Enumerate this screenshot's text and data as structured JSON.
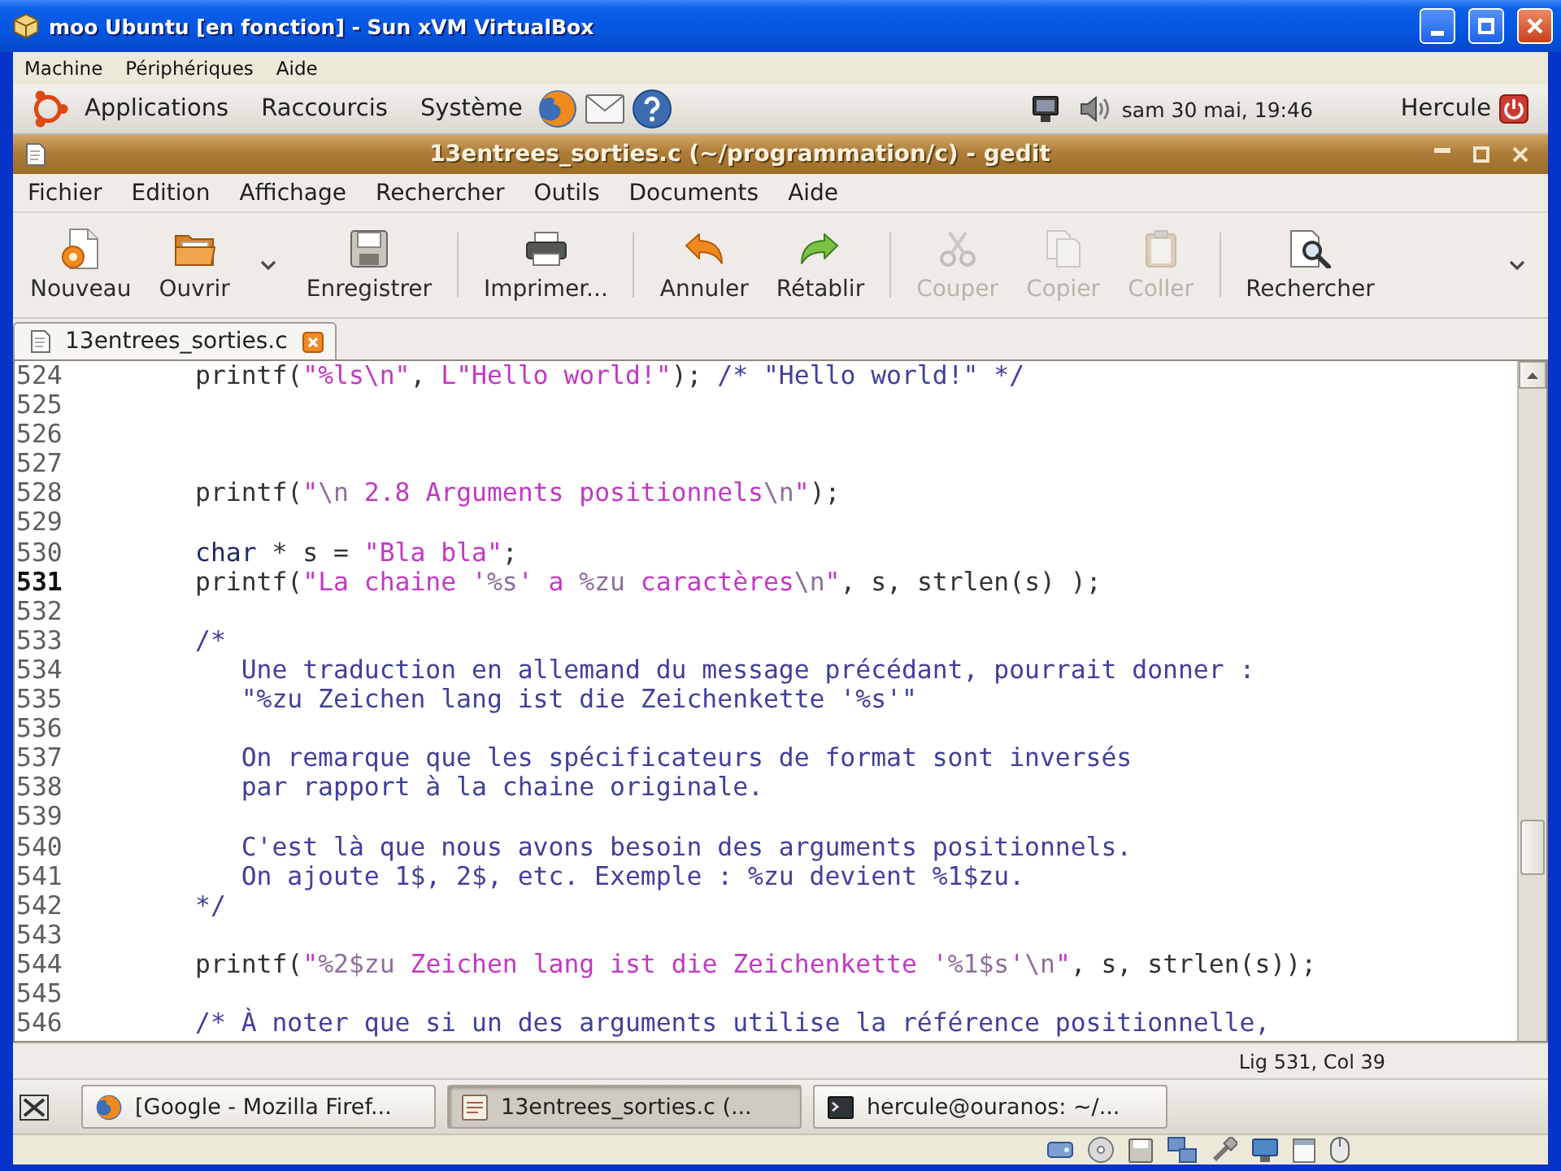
{
  "window": {
    "title": "moo Ubuntu [en fonction] - Sun xVM VirtualBox"
  },
  "vm_menu": [
    {
      "label": "Machine"
    },
    {
      "label": "Périphériques"
    },
    {
      "label": "Aide"
    }
  ],
  "top_panel": {
    "menus": [
      {
        "label": "Applications"
      },
      {
        "label": "Raccourcis"
      },
      {
        "label": "Système"
      }
    ],
    "clock": "sam 30 mai, 19:46",
    "user": "Hercule"
  },
  "gedit": {
    "title": "13entrees_sorties.c (~/programmation/c) - gedit",
    "menu": [
      {
        "label": "Fichier"
      },
      {
        "label": "Edition"
      },
      {
        "label": "Affichage"
      },
      {
        "label": "Rechercher"
      },
      {
        "label": "Outils"
      },
      {
        "label": "Documents"
      },
      {
        "label": "Aide"
      }
    ],
    "toolbar": [
      {
        "kind": "new",
        "label": "Nouveau",
        "disabled": false
      },
      {
        "kind": "open",
        "label": "Ouvrir",
        "disabled": false
      },
      {
        "kind": "dropdown",
        "disabled": false
      },
      {
        "kind": "save",
        "label": "Enregistrer",
        "disabled": false
      },
      {
        "kind": "separator"
      },
      {
        "kind": "print",
        "label": "Imprimer...",
        "disabled": false
      },
      {
        "kind": "separator"
      },
      {
        "kind": "undo",
        "label": "Annuler",
        "disabled": false
      },
      {
        "kind": "redo",
        "label": "Rétablir",
        "disabled": false
      },
      {
        "kind": "separator"
      },
      {
        "kind": "cut",
        "label": "Couper",
        "disabled": true
      },
      {
        "kind": "copy",
        "label": "Copier",
        "disabled": true
      },
      {
        "kind": "paste",
        "label": "Coller",
        "disabled": true
      },
      {
        "kind": "separator"
      },
      {
        "kind": "find",
        "label": "Rechercher",
        "disabled": false
      },
      {
        "kind": "overflow",
        "disabled": false
      }
    ],
    "tabs": [
      {
        "label": "13entrees_sorties.c",
        "selected": true
      }
    ],
    "lines": [
      {
        "number": "524",
        "current": false,
        "segments": [
          {
            "kind": "plain",
            "text": "printf("
          },
          {
            "kind": "string",
            "text": "\"%ls\\n\""
          },
          {
            "kind": "plain",
            "text": ", "
          },
          {
            "kind": "string",
            "text": "L\"Hello world!\""
          },
          {
            "kind": "plain",
            "text": "); "
          },
          {
            "kind": "comment",
            "text": "/* \"Hello world!\" */"
          }
        ]
      },
      {
        "number": "525",
        "current": false
      },
      {
        "number": "526",
        "current": false
      },
      {
        "number": "527",
        "current": false
      },
      {
        "number": "528",
        "current": false,
        "segments": [
          {
            "kind": "plain",
            "text": "printf("
          },
          {
            "kind": "string",
            "text": "\""
          },
          {
            "kind": "escape",
            "text": "\\n"
          },
          {
            "kind": "string",
            "text": " 2.8 Arguments positionnels"
          },
          {
            "kind": "escape",
            "text": "\\n"
          },
          {
            "kind": "string",
            "text": "\""
          },
          {
            "kind": "plain",
            "text": ");"
          }
        ]
      },
      {
        "number": "529",
        "current": false
      },
      {
        "number": "530",
        "current": false,
        "segments": [
          {
            "kind": "keyword",
            "text": "char"
          },
          {
            "kind": "plain",
            "text": " * s = "
          },
          {
            "kind": "string",
            "text": "\"Bla bla\""
          },
          {
            "kind": "plain",
            "text": ";"
          }
        ]
      },
      {
        "number": "531",
        "current": true,
        "segments": [
          {
            "kind": "plain",
            "text": "printf("
          },
          {
            "kind": "string",
            "text": "\"La chaine '"
          },
          {
            "kind": "escape",
            "text": "%s"
          },
          {
            "kind": "string",
            "text": "' a "
          },
          {
            "kind": "escape",
            "text": "%zu"
          },
          {
            "kind": "string",
            "text": " caractères"
          },
          {
            "kind": "escape",
            "text": "\\n"
          },
          {
            "kind": "string",
            "text": "\""
          },
          {
            "kind": "plain",
            "text": ", s, strlen(s) );"
          }
        ]
      },
      {
        "number": "532",
        "current": false
      },
      {
        "number": "533",
        "current": false,
        "segments": [
          {
            "kind": "comment",
            "text": "/*"
          }
        ]
      },
      {
        "number": "534",
        "current": false,
        "segments": [
          {
            "kind": "comment",
            "text": "   Une traduction en allemand du message précédant, pourrait donner :"
          }
        ]
      },
      {
        "number": "535",
        "current": false,
        "segments": [
          {
            "kind": "comment",
            "text": "   \"%zu Zeichen lang ist die Zeichenkette '%s'\""
          }
        ]
      },
      {
        "number": "536",
        "current": false
      },
      {
        "number": "537",
        "current": false,
        "segments": [
          {
            "kind": "comment",
            "text": "   On remarque que les spécificateurs de format sont inversés"
          }
        ]
      },
      {
        "number": "538",
        "current": false,
        "segments": [
          {
            "kind": "comment",
            "text": "   par rapport à la chaine originale."
          }
        ]
      },
      {
        "number": "539",
        "current": false
      },
      {
        "number": "540",
        "current": false,
        "segments": [
          {
            "kind": "comment",
            "text": "   C'est là que nous avons besoin des arguments positionnels."
          }
        ]
      },
      {
        "number": "541",
        "current": false,
        "segments": [
          {
            "kind": "comment",
            "text": "   On ajoute 1$, 2$, etc. Exemple : %zu devient %1$zu."
          }
        ]
      },
      {
        "number": "542",
        "current": false,
        "segments": [
          {
            "kind": "comment",
            "text": "*/"
          }
        ]
      },
      {
        "number": "543",
        "current": false
      },
      {
        "number": "544",
        "current": false,
        "segments": [
          {
            "kind": "plain",
            "text": "printf("
          },
          {
            "kind": "string",
            "text": "\""
          },
          {
            "kind": "escape",
            "text": "%2$zu"
          },
          {
            "kind": "string",
            "text": " Zeichen lang ist die Zeichenkette '"
          },
          {
            "kind": "escape",
            "text": "%1$s"
          },
          {
            "kind": "string",
            "text": "'"
          },
          {
            "kind": "escape",
            "text": "\\n"
          },
          {
            "kind": "string",
            "text": "\""
          },
          {
            "kind": "plain",
            "text": ", s, strlen(s));"
          }
        ]
      },
      {
        "number": "545",
        "current": false
      },
      {
        "number": "546",
        "current": false,
        "segments": [
          {
            "kind": "comment",
            "text": "/* À noter que si un des arguments utilise la référence positionnelle,"
          }
        ]
      }
    ],
    "status": "Lig 531, Col 39"
  },
  "taskbar": {
    "tasks": [
      {
        "kind": "browser",
        "label": "[Google - Mozilla Firef...",
        "selected": false
      },
      {
        "kind": "editor",
        "label": "13entrees_sorties.c (...",
        "selected": true
      },
      {
        "kind": "terminal",
        "label": "hercule@ouranos: ~/...",
        "selected": false
      }
    ]
  }
}
